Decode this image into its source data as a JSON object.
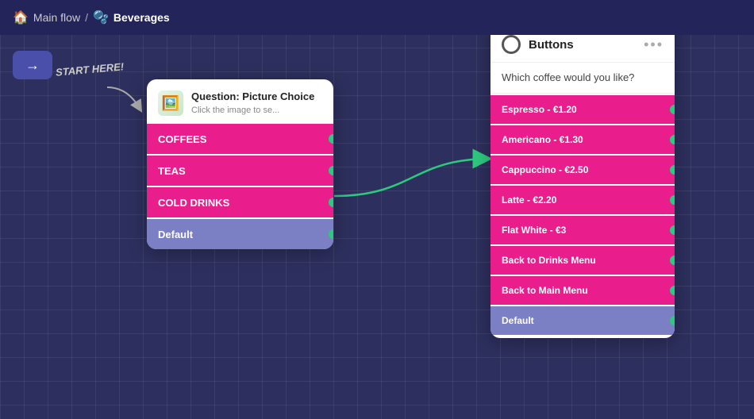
{
  "topbar": {
    "home_icon": "🏠",
    "main_flow_label": "Main flow",
    "separator": "/",
    "current_label": "Beverages",
    "bev_icon": "🫧"
  },
  "entry": {
    "arrow": "→"
  },
  "start_here": {
    "label": "START HERE!"
  },
  "question_card": {
    "icon": "🖼️",
    "title": "Question: Picture Choice",
    "subtitle": "Click the image to se...",
    "choices": [
      {
        "label": "COFFEES",
        "is_default": false
      },
      {
        "label": "TEAS",
        "is_default": false
      },
      {
        "label": "COLD DRINKS",
        "is_default": false
      },
      {
        "label": "Default",
        "is_default": true
      }
    ]
  },
  "buttons_card": {
    "title": "Buttons",
    "menu_icon": "•••",
    "question": "Which coffee would you like?",
    "options": [
      {
        "label": "Espresso - €1.20",
        "is_default": false
      },
      {
        "label": "Americano - €1.30",
        "is_default": false
      },
      {
        "label": "Cappuccino - €2.50",
        "is_default": false
      },
      {
        "label": "Latte - €2.20",
        "is_default": false
      },
      {
        "label": "Flat White - €3",
        "is_default": false
      },
      {
        "label": "Back to Drinks Menu",
        "is_default": false
      },
      {
        "label": "Back to Main Menu",
        "is_default": false
      },
      {
        "label": "Default",
        "is_default": true
      }
    ]
  }
}
